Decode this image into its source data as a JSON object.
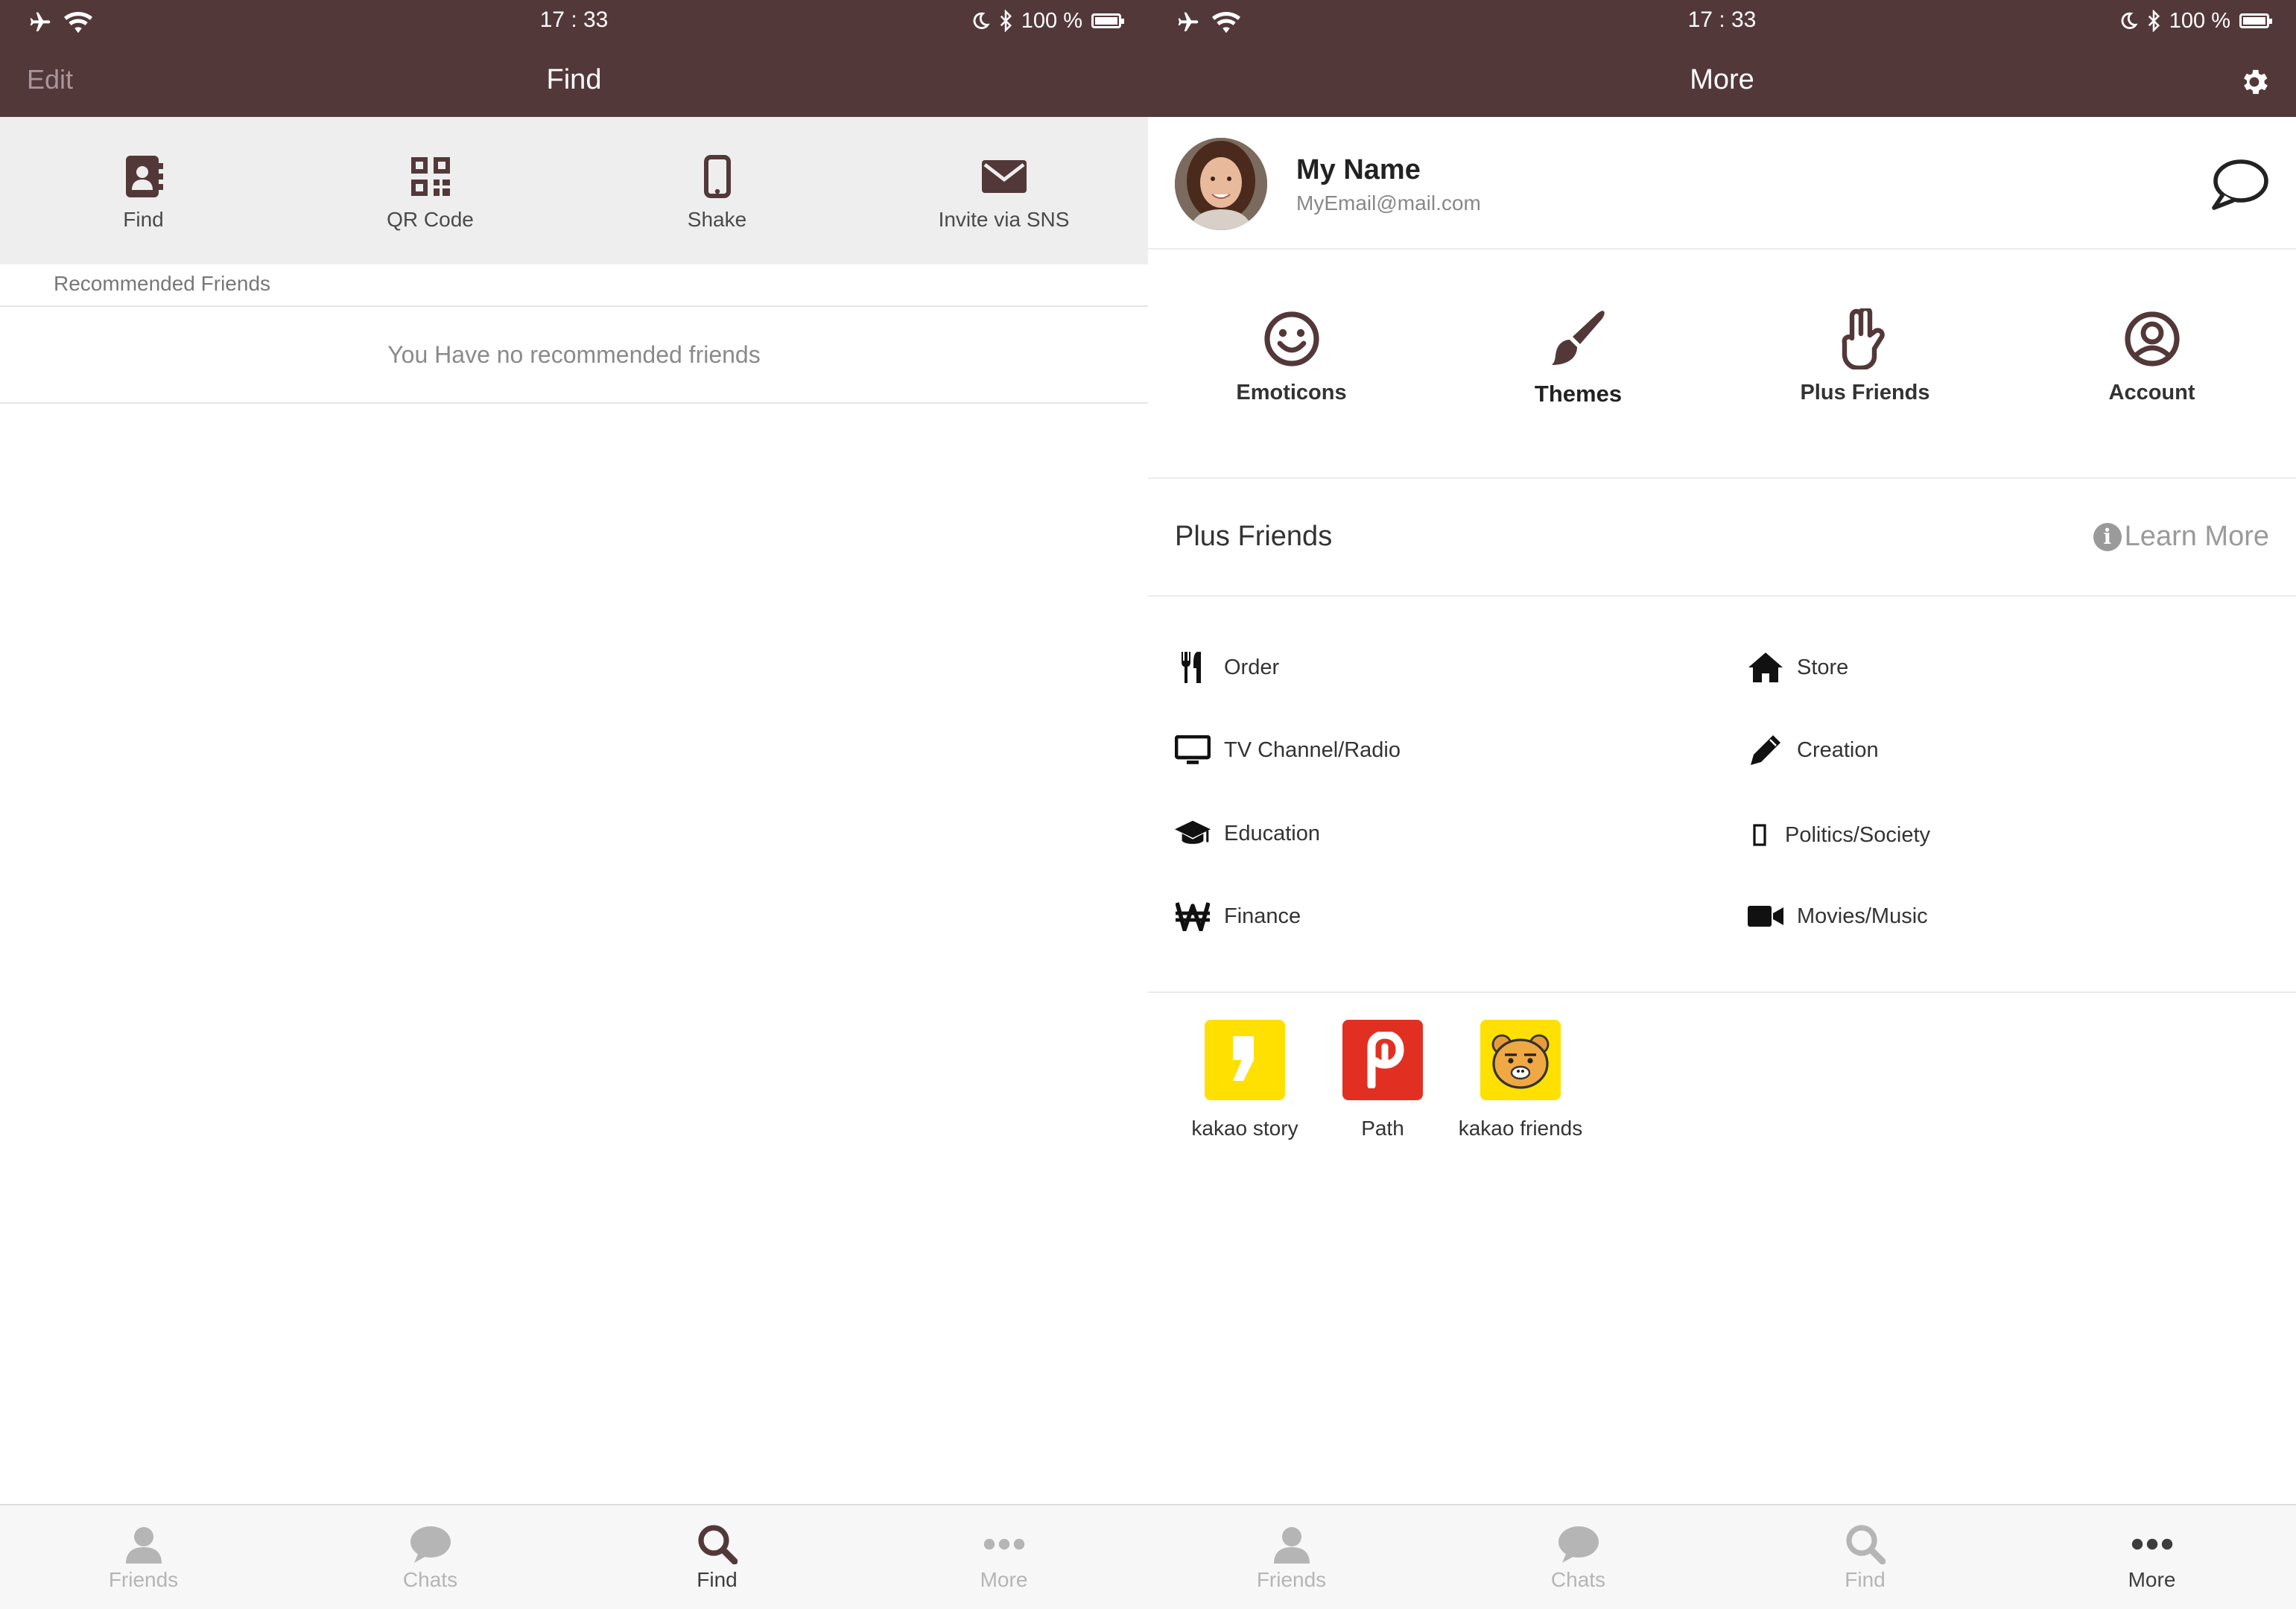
{
  "colors": {
    "header_bg": "#53383a",
    "icon_dark": "#53383a",
    "kakao_yellow": "#ffe000",
    "path_red": "#e13022"
  },
  "status": {
    "time": "17 : 33",
    "battery": "100 %"
  },
  "find_screen": {
    "nav": {
      "edit_label": "Edit",
      "title": "Find"
    },
    "tools": [
      {
        "label": "Find",
        "icon": "contact-book-icon"
      },
      {
        "label": "QR Code",
        "icon": "qr-code-icon"
      },
      {
        "label": "Shake",
        "icon": "phone-icon"
      },
      {
        "label": "Invite via SNS",
        "icon": "envelope-icon"
      }
    ],
    "recommended_header": "Recommended Friends",
    "recommended_empty": "You Have no recommended friends"
  },
  "more_screen": {
    "nav": {
      "title": "More"
    },
    "profile": {
      "name": "My Name",
      "email": "MyEmail@mail.com"
    },
    "quick_items": [
      {
        "label": "Emoticons",
        "icon": "smiley-icon"
      },
      {
        "label": "Themes",
        "icon": "paint-brush-icon"
      },
      {
        "label": "Plus Friends",
        "icon": "hand-icon"
      },
      {
        "label": "Account",
        "icon": "account-icon"
      }
    ],
    "plus_friends": {
      "title": "Plus Friends",
      "learn_more": "Learn More",
      "categories_left": [
        {
          "label": "Order",
          "icon": "fork-knife-icon"
        },
        {
          "label": "TV Channel/Radio",
          "icon": "monitor-icon"
        },
        {
          "label": "Education",
          "icon": "graduation-cap-icon"
        },
        {
          "label": "Finance",
          "icon": "won-icon"
        }
      ],
      "categories_right": [
        {
          "label": "Store",
          "icon": "home-icon"
        },
        {
          "label": "Creation",
          "icon": "pencil-icon"
        },
        {
          "label": "Politics/Society",
          "icon": "rectangle-icon"
        },
        {
          "label": "Movies/Music",
          "icon": "video-camera-icon"
        }
      ]
    },
    "apps": [
      {
        "label": "kakao story",
        "icon": "kakao-story-icon"
      },
      {
        "label": "Path",
        "icon": "path-icon"
      },
      {
        "label": "kakao friends",
        "icon": "kakao-friends-icon"
      }
    ]
  },
  "tabs": [
    {
      "label": "Friends",
      "icon": "person-icon"
    },
    {
      "label": "Chats",
      "icon": "chat-icon"
    },
    {
      "label": "Find",
      "icon": "search-icon"
    },
    {
      "label": "More",
      "icon": "more-dots-icon"
    }
  ]
}
